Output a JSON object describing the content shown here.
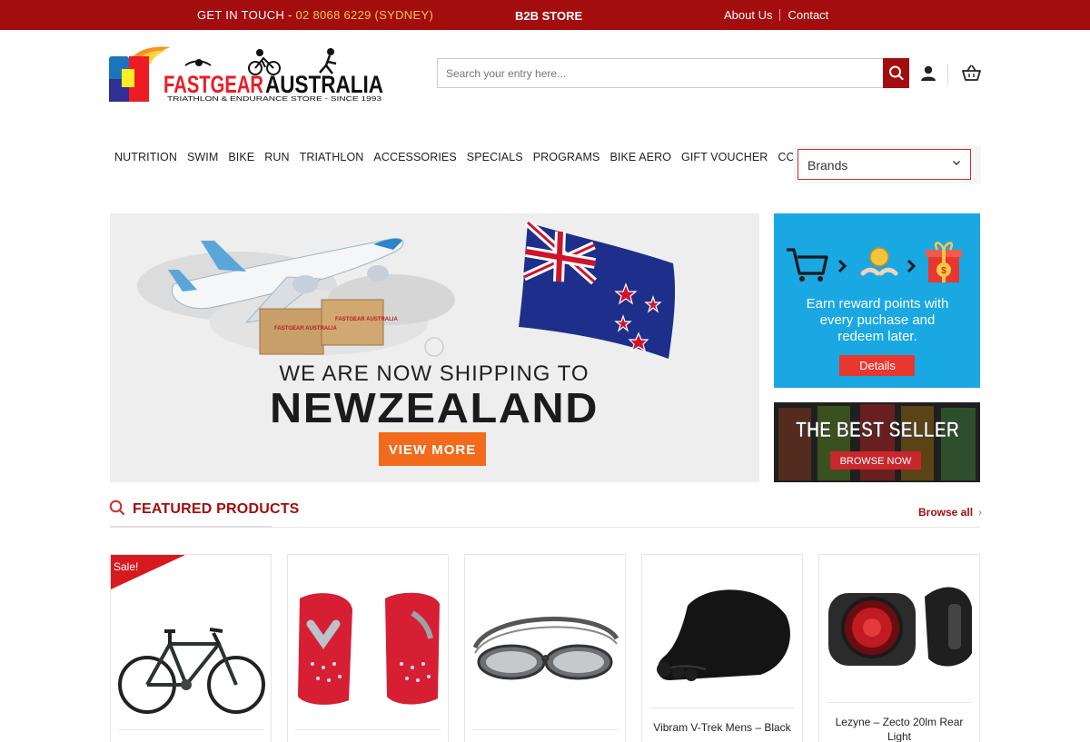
{
  "topbar": {
    "get_in_touch": "GET IN TOUCH - ",
    "phone": "02 8068 6229 (SYDNEY)",
    "b2b": "B2B STORE",
    "about": "About Us",
    "contact": "Contact"
  },
  "logo": {
    "name": "FASTGEARAUSTRALIA",
    "tagline": "TRIATHLON & ENDURANCE STORE - SINCE 1993"
  },
  "search": {
    "placeholder": "Search your entry here..."
  },
  "nav": {
    "items": [
      "NUTRITION",
      "SWIM",
      "BIKE",
      "RUN",
      "TRIATHLON",
      "ACCESSORIES",
      "SPECIALS",
      "PROGRAMS",
      "BIKE AERO",
      "GIFT VOUCHER",
      "CONTACT"
    ],
    "brands": "Brands"
  },
  "hero": {
    "line1": "WE ARE NOW SHIPPING TO",
    "line2": "NEWZEALAND",
    "cta": "VIEW MORE",
    "box_label": "FASTGEAR AUSTRALIA"
  },
  "side1": {
    "text1": "Earn reward points with",
    "text2": "every puchase and",
    "text3": "redeem later.",
    "cta": "Details"
  },
  "side2": {
    "title": "THE BEST SELLER",
    "cta": "BROWSE NOW"
  },
  "featured": {
    "title": "FEATURED PRODUCTS",
    "browse": "Browse all",
    "sale_label": "Sale!",
    "products": [
      {
        "name": ""
      },
      {
        "name": ""
      },
      {
        "name": ""
      },
      {
        "name": "Vibram V-Trek Mens – Black"
      },
      {
        "name": "Lezyne – Zecto 20lm Rear Light"
      }
    ]
  },
  "colors": {
    "brand": "#a30d0d",
    "accent": "#f4c84a",
    "cta": "#f26b1d",
    "reward_bg": "#1aa8e3"
  }
}
